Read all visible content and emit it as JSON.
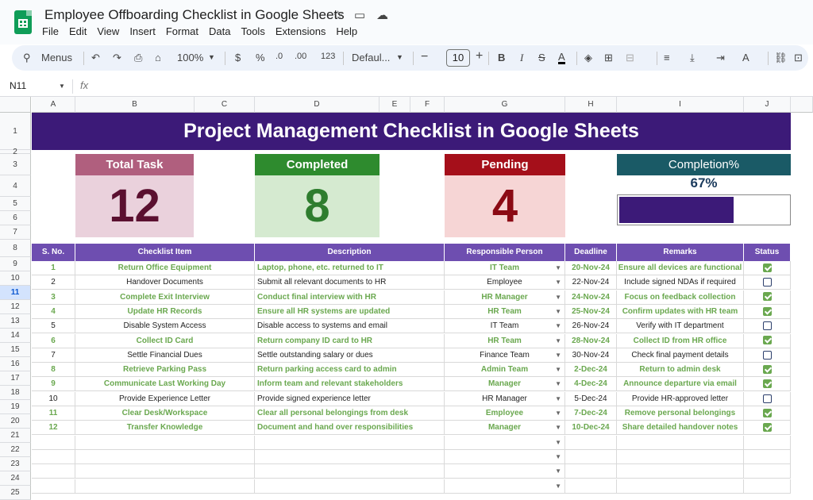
{
  "app": {
    "doc_title": "Employee Offboarding Checklist in Google Sheets",
    "menu": [
      "File",
      "Edit",
      "View",
      "Insert",
      "Format",
      "Data",
      "Tools",
      "Extensions",
      "Help"
    ]
  },
  "toolbar": {
    "search_label": "Menus",
    "zoom": "100%",
    "currency": "$",
    "percent": "%",
    "decimal": ".0",
    "more_decimal": ".00",
    "number_format": "123",
    "font": "Defaul...",
    "font_size": "10"
  },
  "formula_bar": {
    "name_box": "N11",
    "fx": "fx"
  },
  "columns": [
    "A",
    "B",
    "C",
    "D",
    "E",
    "F",
    "G",
    "H",
    "I",
    "J"
  ],
  "rows": [
    "1",
    "2",
    "3",
    "4",
    "5",
    "6",
    "7",
    "8",
    "9",
    "10",
    "11",
    "12",
    "13",
    "14",
    "15",
    "16",
    "17",
    "18",
    "19",
    "20",
    "21",
    "22",
    "23",
    "24",
    "25"
  ],
  "banner_title": "Project Management Checklist in Google Sheets",
  "kpis": {
    "total": {
      "label": "Total Task",
      "value": "12"
    },
    "completed": {
      "label": "Completed",
      "value": "8"
    },
    "pending": {
      "label": "Pending",
      "value": "4"
    },
    "completion": {
      "label": "Completion%",
      "value": "67%",
      "fraction": 0.67
    }
  },
  "colors": {
    "banner": "#3c1a78",
    "header": "#6e4eb0",
    "done_text": "#6aa84f",
    "total": "#b05f7e",
    "completed": "#2e8b2e",
    "pending": "#a50f1a",
    "completion": "#1a5a66"
  },
  "table": {
    "headers": [
      "S. No.",
      "Checklist Item",
      "Description",
      "Responsible Person",
      "Deadline",
      "Remarks",
      "Status"
    ],
    "rows": [
      {
        "no": "1",
        "item": "Return Office Equipment",
        "desc": "Laptop, phone, etc. returned to IT",
        "person": "IT Team",
        "deadline": "20-Nov-24",
        "remarks": "Ensure all devices are functional",
        "done": true
      },
      {
        "no": "2",
        "item": "Handover Documents",
        "desc": "Submit all relevant documents to HR",
        "person": "Employee",
        "deadline": "22-Nov-24",
        "remarks": "Include signed NDAs if required",
        "done": false
      },
      {
        "no": "3",
        "item": "Complete Exit Interview",
        "desc": "Conduct final interview with HR",
        "person": "HR Manager",
        "deadline": "24-Nov-24",
        "remarks": "Focus on feedback collection",
        "done": true
      },
      {
        "no": "4",
        "item": "Update HR Records",
        "desc": "Ensure all HR systems are updated",
        "person": "HR Team",
        "deadline": "25-Nov-24",
        "remarks": "Confirm updates with HR team",
        "done": true
      },
      {
        "no": "5",
        "item": "Disable System Access",
        "desc": "Disable access to systems and email",
        "person": "IT Team",
        "deadline": "26-Nov-24",
        "remarks": "Verify with IT department",
        "done": false
      },
      {
        "no": "6",
        "item": "Collect ID Card",
        "desc": "Return company ID card to HR",
        "person": "HR Team",
        "deadline": "28-Nov-24",
        "remarks": "Collect ID from HR office",
        "done": true
      },
      {
        "no": "7",
        "item": "Settle Financial Dues",
        "desc": "Settle outstanding salary or dues",
        "person": "Finance Team",
        "deadline": "30-Nov-24",
        "remarks": "Check final payment details",
        "done": false
      },
      {
        "no": "8",
        "item": "Retrieve Parking Pass",
        "desc": "Return parking access card to admin",
        "person": "Admin Team",
        "deadline": "2-Dec-24",
        "remarks": "Return to admin desk",
        "done": true
      },
      {
        "no": "9",
        "item": "Communicate Last Working Day",
        "desc": "Inform team and relevant stakeholders",
        "person": "Manager",
        "deadline": "4-Dec-24",
        "remarks": "Announce departure via email",
        "done": true
      },
      {
        "no": "10",
        "item": "Provide Experience Letter",
        "desc": "Provide signed experience letter",
        "person": "HR Manager",
        "deadline": "5-Dec-24",
        "remarks": "Provide HR-approved letter",
        "done": false
      },
      {
        "no": "11",
        "item": "Clear Desk/Workspace",
        "desc": "Clear all personal belongings from desk",
        "person": "Employee",
        "deadline": "7-Dec-24",
        "remarks": "Remove personal belongings",
        "done": true
      },
      {
        "no": "12",
        "item": "Transfer Knowledge",
        "desc": "Document and hand over responsibilities",
        "person": "Manager",
        "deadline": "10-Dec-24",
        "remarks": "Share detailed handover notes",
        "done": true
      }
    ]
  }
}
